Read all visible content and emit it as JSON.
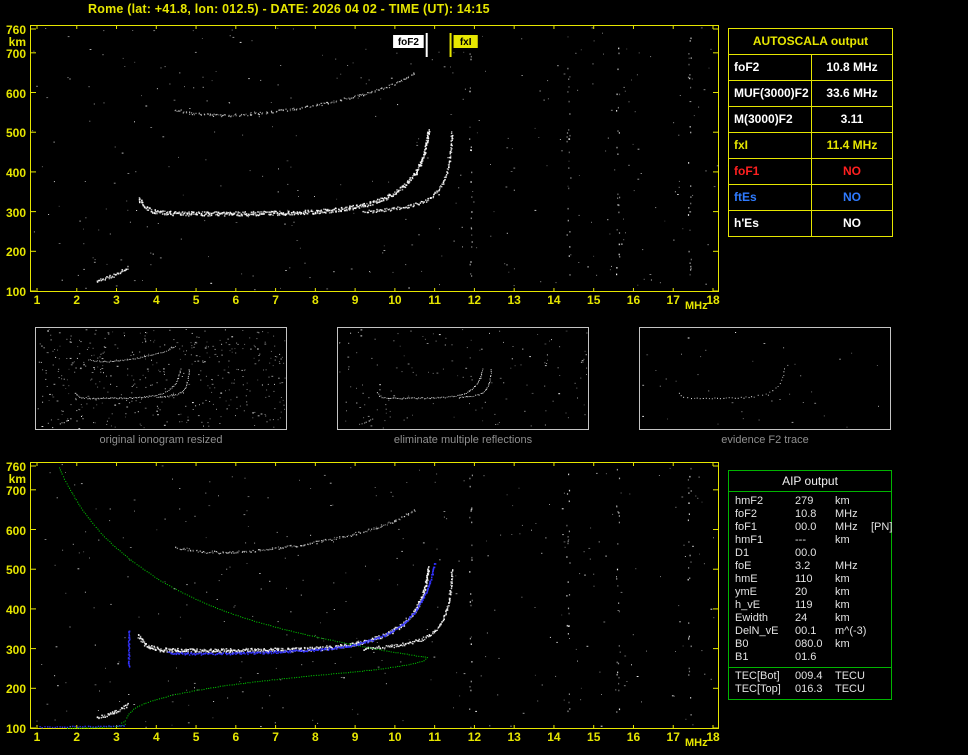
{
  "title": "Rome (lat: +41.8, lon: 012.5) - DATE: 2026 04 02 - TIME (UT): 14:15",
  "colors": {
    "axis_yellow": "#e6e600",
    "trace_white": "#ffffff",
    "trace_blue": "#3333ff",
    "profile_green": "#00c400",
    "aip_border_green": "#00b400",
    "no_red": "#ff2020",
    "es_blue": "#2f7bff"
  },
  "autoscala": {
    "header": "AUTOSCALA output",
    "rows": [
      {
        "label": "foF2",
        "value": "10.8 MHz",
        "color": "#ffffff"
      },
      {
        "label": "MUF(3000)F2",
        "value": "33.6 MHz",
        "color": "#ffffff"
      },
      {
        "label": "M(3000)F2",
        "value": "3.11",
        "color": "#ffffff"
      },
      {
        "label": "fxI",
        "value": "11.4 MHz",
        "color": "#e6e600"
      },
      {
        "label": "foF1",
        "value": "NO",
        "color": "#ff2020"
      },
      {
        "label": "ftEs",
        "value": "NO",
        "color": "#2f7bff"
      },
      {
        "label": "h'Es",
        "value": "NO",
        "color": "#ffffff"
      }
    ]
  },
  "thumbnails": [
    {
      "caption": "original ionogram resized"
    },
    {
      "caption": "eliminate multiple reflections"
    },
    {
      "caption": "evidence F2 trace"
    }
  ],
  "aip": {
    "header": "AIP output",
    "rows": [
      {
        "name": "hmF2",
        "value": "279",
        "unit": "km",
        "extra": ""
      },
      {
        "name": "foF2",
        "value": "10.8",
        "unit": "MHz",
        "extra": ""
      },
      {
        "name": "foF1",
        "value": "00.0",
        "unit": "MHz",
        "extra": "[PN]"
      },
      {
        "name": "hmF1",
        "value": "---",
        "unit": "km",
        "extra": ""
      },
      {
        "name": "D1",
        "value": "00.0",
        "unit": "",
        "extra": ""
      },
      {
        "name": "foE",
        "value": "3.2",
        "unit": "MHz",
        "extra": ""
      },
      {
        "name": "hmE",
        "value": "110",
        "unit": "km",
        "extra": ""
      },
      {
        "name": "ymE",
        "value": "20",
        "unit": "km",
        "extra": ""
      },
      {
        "name": "h_vE",
        "value": "119",
        "unit": "km",
        "extra": ""
      },
      {
        "name": "Ewidth",
        "value": "24",
        "unit": "km",
        "extra": ""
      },
      {
        "name": "DelN_vE",
        "value": "00.1",
        "unit": "m^(-3)",
        "extra": ""
      },
      {
        "name": "B0",
        "value": "080.0",
        "unit": "km",
        "extra": ""
      },
      {
        "name": "B1",
        "value": "01.6",
        "unit": "",
        "extra": ""
      }
    ],
    "tec_rows": [
      {
        "name": "TEC[Bot]",
        "value": "009.4",
        "unit": "TECU"
      },
      {
        "name": "TEC[Top]",
        "value": "016.3",
        "unit": "TECU"
      }
    ]
  },
  "chart_data": {
    "type": "scatter",
    "title": "Vertical incidence ionogram, Rome, 2026-04-02 14:15 UT",
    "xlabel": "MHz",
    "ylabel": "km",
    "xlim": [
      1,
      18
    ],
    "ylim": [
      100,
      760
    ],
    "xticks": [
      1,
      2,
      3,
      4,
      5,
      6,
      7,
      8,
      9,
      10,
      11,
      12,
      13,
      14,
      15,
      16,
      17,
      18
    ],
    "yticks": [
      100,
      200,
      300,
      400,
      500,
      600,
      700,
      760
    ],
    "noise_columns_mhz": [
      11.9,
      14.35,
      15.6,
      17.4
    ],
    "markers": [
      {
        "label": "foF2",
        "freq_mhz": 10.8,
        "color": "#ffffff",
        "label_side": "left"
      },
      {
        "label": "fxI",
        "freq_mhz": 11.4,
        "color": "#e6e600",
        "label_side": "right"
      }
    ],
    "traces": {
      "e_region": {
        "color": "#ffffff",
        "points": [
          [
            2.5,
            127
          ],
          [
            2.65,
            131
          ],
          [
            2.8,
            136
          ],
          [
            2.95,
            142
          ],
          [
            3.1,
            149
          ],
          [
            3.22,
            157
          ],
          [
            3.3,
            164
          ]
        ]
      },
      "f2_ordinary": {
        "color": "#ffffff",
        "points": [
          [
            3.55,
            332
          ],
          [
            3.7,
            314
          ],
          [
            3.85,
            304
          ],
          [
            4.1,
            299
          ],
          [
            4.4,
            297
          ],
          [
            4.8,
            296
          ],
          [
            5.2,
            296
          ],
          [
            5.6,
            296
          ],
          [
            6.0,
            296
          ],
          [
            6.4,
            297
          ],
          [
            6.8,
            297
          ],
          [
            7.2,
            298
          ],
          [
            7.6,
            299
          ],
          [
            8.0,
            301
          ],
          [
            8.35,
            304
          ],
          [
            8.7,
            308
          ],
          [
            9.0,
            313
          ],
          [
            9.3,
            320
          ],
          [
            9.55,
            328
          ],
          [
            9.8,
            338
          ],
          [
            10.0,
            350
          ],
          [
            10.2,
            364
          ],
          [
            10.35,
            379
          ],
          [
            10.5,
            397
          ],
          [
            10.6,
            415
          ],
          [
            10.68,
            434
          ],
          [
            10.74,
            454
          ],
          [
            10.79,
            474
          ],
          [
            10.82,
            492
          ],
          [
            10.84,
            508
          ]
        ]
      },
      "f2_extraordinary": {
        "color": "#ffffff",
        "points": [
          [
            9.2,
            301
          ],
          [
            9.5,
            303
          ],
          [
            9.8,
            306
          ],
          [
            10.1,
            310
          ],
          [
            10.35,
            315
          ],
          [
            10.6,
            322
          ],
          [
            10.8,
            331
          ],
          [
            10.97,
            343
          ],
          [
            11.1,
            357
          ],
          [
            11.2,
            374
          ],
          [
            11.28,
            393
          ],
          [
            11.34,
            415
          ],
          [
            11.38,
            440
          ],
          [
            11.41,
            466
          ],
          [
            11.42,
            490
          ],
          [
            11.42,
            505
          ]
        ]
      },
      "second_hop": {
        "color": "#d8d8d8",
        "points": [
          [
            4.45,
            557
          ],
          [
            4.8,
            550
          ],
          [
            5.2,
            545
          ],
          [
            5.6,
            543
          ],
          [
            6.0,
            544
          ],
          [
            6.4,
            547
          ],
          [
            6.8,
            551
          ],
          [
            7.2,
            556
          ],
          [
            7.6,
            562
          ],
          [
            8.0,
            569
          ],
          [
            8.4,
            577
          ],
          [
            8.8,
            586
          ],
          [
            9.2,
            596
          ],
          [
            9.55,
            606
          ],
          [
            9.85,
            617
          ],
          [
            10.1,
            628
          ],
          [
            10.35,
            641
          ],
          [
            10.55,
            652
          ]
        ]
      },
      "restored_vertical": {
        "color": "#3333ff",
        "points": [
          [
            3.3,
            255
          ],
          [
            3.3,
            350
          ]
        ]
      },
      "restored_trace": {
        "color": "#3333ff",
        "points": [
          [
            4.3,
            291
          ],
          [
            4.7,
            289
          ],
          [
            5.1,
            288
          ],
          [
            5.5,
            288
          ],
          [
            5.9,
            289
          ],
          [
            6.3,
            290
          ],
          [
            6.7,
            291
          ],
          [
            7.1,
            293
          ],
          [
            7.5,
            295
          ],
          [
            7.9,
            297
          ],
          [
            8.3,
            300
          ],
          [
            8.65,
            305
          ],
          [
            9.0,
            311
          ],
          [
            9.3,
            319
          ],
          [
            9.6,
            329
          ],
          [
            9.85,
            341
          ],
          [
            10.1,
            356
          ],
          [
            10.3,
            373
          ],
          [
            10.5,
            394
          ],
          [
            10.65,
            418
          ],
          [
            10.78,
            444
          ],
          [
            10.88,
            472
          ],
          [
            10.95,
            500
          ],
          [
            11.0,
            522
          ]
        ]
      },
      "baseline_blue": {
        "color": "#3333ff",
        "points": [
          [
            1.05,
            104
          ],
          [
            1.5,
            104
          ],
          [
            1.95,
            105
          ],
          [
            2.4,
            105
          ],
          [
            2.85,
            106
          ],
          [
            3.25,
            107
          ]
        ]
      },
      "profile": {
        "color": "#00c400",
        "points": [
          [
            1.55,
            757
          ],
          [
            1.62,
            741
          ],
          [
            1.71,
            722
          ],
          [
            1.83,
            700
          ],
          [
            1.97,
            676
          ],
          [
            2.14,
            650
          ],
          [
            2.35,
            622
          ],
          [
            2.6,
            592
          ],
          [
            2.9,
            562
          ],
          [
            3.25,
            532
          ],
          [
            3.65,
            502
          ],
          [
            4.1,
            472
          ],
          [
            4.6,
            444
          ],
          [
            5.15,
            418
          ],
          [
            5.75,
            394
          ],
          [
            6.4,
            372
          ],
          [
            7.1,
            352
          ],
          [
            7.85,
            334
          ],
          [
            8.6,
            318
          ],
          [
            9.3,
            304
          ],
          [
            9.9,
            293
          ],
          [
            10.35,
            286
          ],
          [
            10.65,
            281
          ],
          [
            10.8,
            279
          ],
          [
            10.72,
            271
          ],
          [
            10.45,
            263
          ],
          [
            10.0,
            255
          ],
          [
            9.4,
            247
          ],
          [
            8.7,
            240
          ],
          [
            7.95,
            233
          ],
          [
            7.15,
            225
          ],
          [
            6.35,
            216
          ],
          [
            5.6,
            206
          ],
          [
            4.95,
            195
          ],
          [
            4.4,
            184
          ],
          [
            3.95,
            172
          ],
          [
            3.62,
            160
          ],
          [
            3.42,
            148
          ],
          [
            3.3,
            137
          ],
          [
            3.24,
            127
          ],
          [
            3.21,
            119
          ],
          [
            3.12,
            114
          ],
          [
            3.2,
            110
          ],
          [
            3.08,
            106
          ],
          [
            2.8,
            104
          ],
          [
            2.45,
            102
          ],
          [
            2.05,
            101
          ],
          [
            1.7,
            100
          ]
        ]
      }
    }
  }
}
